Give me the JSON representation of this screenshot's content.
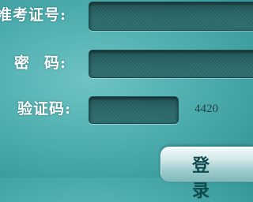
{
  "form": {
    "username_label": "准考证号:",
    "username_value": "",
    "password_label_1": "密",
    "password_label_2": "码:",
    "password_value": "",
    "captcha_label": "验证码:",
    "captcha_value": "",
    "captcha_code": "4420",
    "login_label": "登 录"
  }
}
